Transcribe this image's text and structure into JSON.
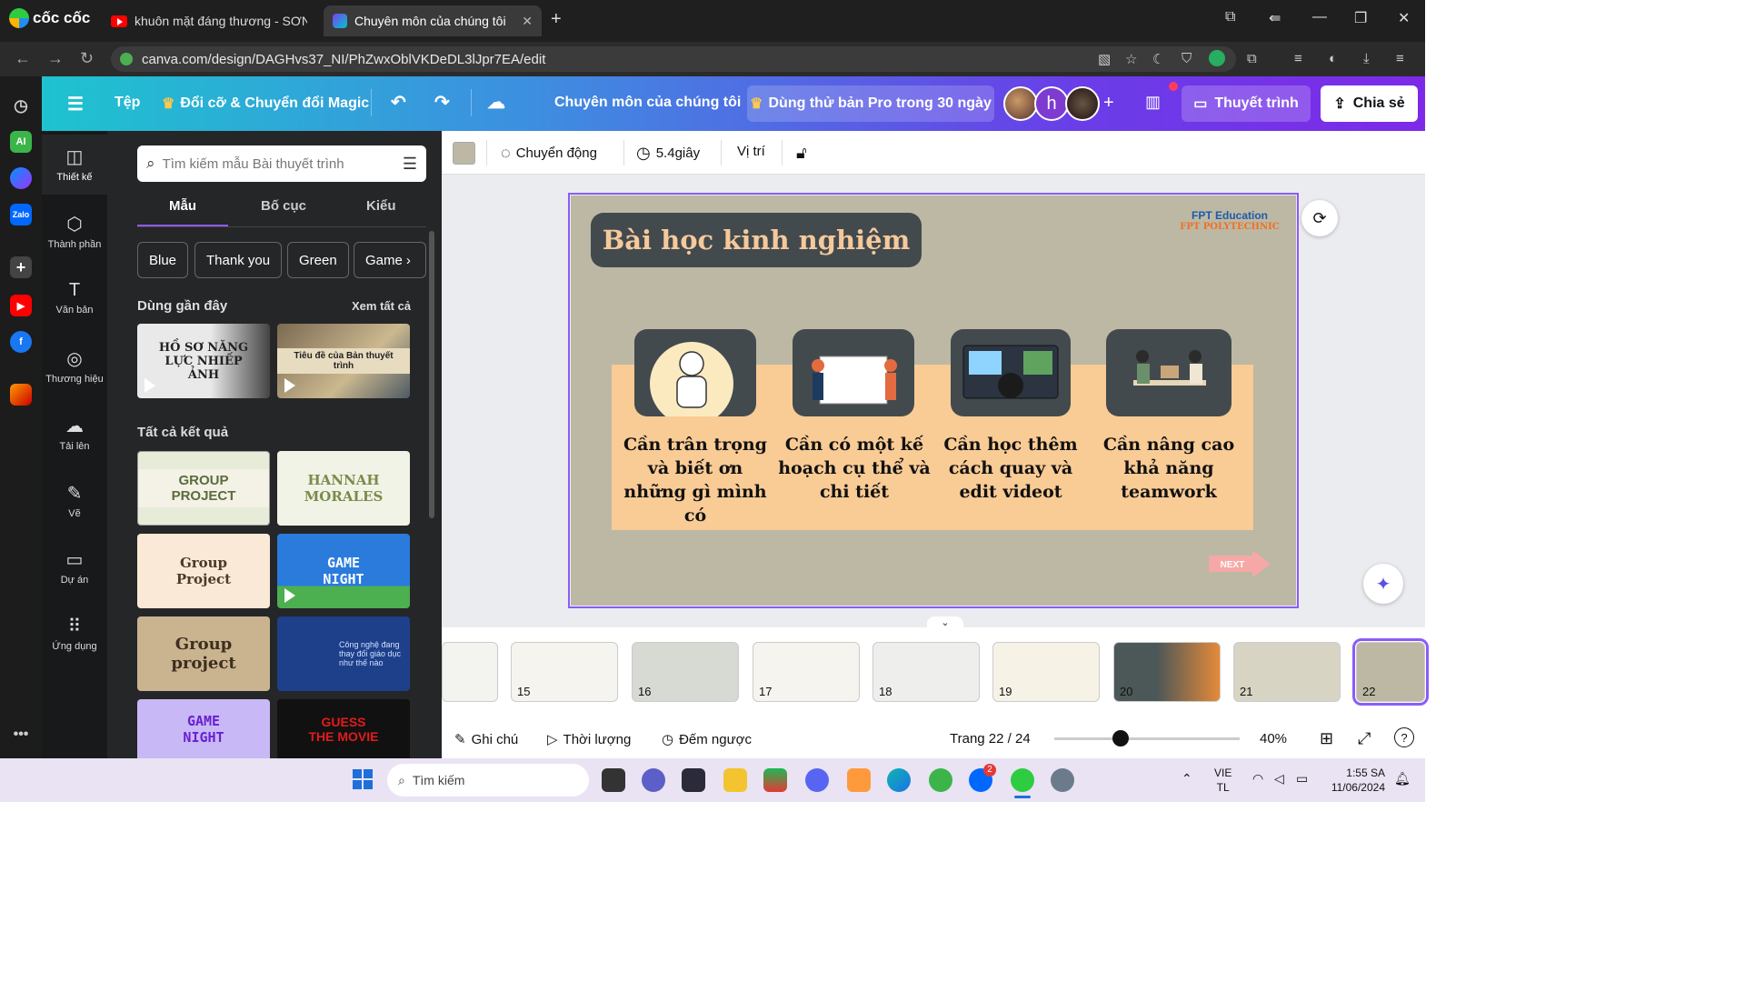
{
  "browser": {
    "brand": "cốc cốc",
    "tabs": [
      {
        "title": "khuôn mặt đáng thương - SƠN TÙ"
      },
      {
        "title": "Chuyên môn của chúng tôi - "
      }
    ],
    "url": "canva.com/design/DAGHvs37_NI/PhZwxOblVKDeDL3lJpr7EA/edit"
  },
  "header": {
    "menu_file": "Tệp",
    "magic": "Đổi cỡ & Chuyển đổi Magic",
    "doc_title": "Chuyên môn của chúng tôi",
    "pro_trial": "Dùng thử bản Pro trong 30 ngày",
    "avatar_letter": "h",
    "present": "Thuyết trình",
    "share": "Chia sẻ"
  },
  "rail": [
    {
      "label": "Thiết kế",
      "icon": "layout-icon"
    },
    {
      "label": "Thành phần",
      "icon": "elements-icon"
    },
    {
      "label": "Văn bản",
      "icon": "text-icon"
    },
    {
      "label": "Thương hiệu",
      "icon": "brand-icon"
    },
    {
      "label": "Tải lên",
      "icon": "upload-icon"
    },
    {
      "label": "Vẽ",
      "icon": "draw-icon"
    },
    {
      "label": "Dự án",
      "icon": "folder-icon"
    },
    {
      "label": "Ứng dụng",
      "icon": "apps-icon"
    }
  ],
  "panel": {
    "search_placeholder": "Tìm kiếm mẫu Bài thuyết trình",
    "tabs": [
      "Mẫu",
      "Bố cục",
      "Kiểu"
    ],
    "chips": [
      "Blue",
      "Thank you",
      "Green",
      "Game"
    ],
    "recent_heading": "Dùng gần đây",
    "see_all": "Xem tất cả",
    "recent": [
      {
        "text": "HỒ SƠ NĂNG LỰC NHIẾP ẢNH"
      },
      {
        "text": "Tiêu đề của Bản thuyết trình"
      }
    ],
    "results_heading": "Tất cả kết quả",
    "results": [
      {
        "text": "GROUP PROJECT"
      },
      {
        "text": "HANNAH MORALES"
      },
      {
        "text": "Group Project"
      },
      {
        "text": "GAME NIGHT"
      },
      {
        "text": "Group project"
      },
      {
        "text": "Công nghệ đang thay đổi giáo dục như thế nào"
      },
      {
        "text": "GAME NIGHT"
      },
      {
        "text": "GUESS THE MOVIE"
      }
    ]
  },
  "toolbar": {
    "animate": "Chuyển động",
    "duration": "5.4giây",
    "position": "Vị trí"
  },
  "slide": {
    "title": "Bài học kinh nghiệm",
    "logo_fpt": "FPT Education",
    "logo_poly": "FPT POLYTECHNIC",
    "cards": [
      {
        "text": "Cần trân trọng và biết ơn những gì mình có"
      },
      {
        "text": "Cần có một kế hoạch cụ thể và chi tiết"
      },
      {
        "text": "Cần học thêm cách quay và edit videot"
      },
      {
        "text": "Cần nâng cao khả năng teamwork"
      }
    ],
    "next_label": "NEXT"
  },
  "filmstrip": [
    "15",
    "16",
    "17",
    "18",
    "19",
    "20",
    "21",
    "22"
  ],
  "bottom": {
    "notes": "Ghi chú",
    "duration": "Thời lượng",
    "timer": "Đếm ngược",
    "page": "Trang 22 / 24",
    "zoom": "40%"
  },
  "taskbar": {
    "search": "Tìm kiếm",
    "lang1": "VIE",
    "lang2": "TL",
    "time": "1:55 SA",
    "date": "11/06/2024",
    "zalo_badge": "2"
  }
}
